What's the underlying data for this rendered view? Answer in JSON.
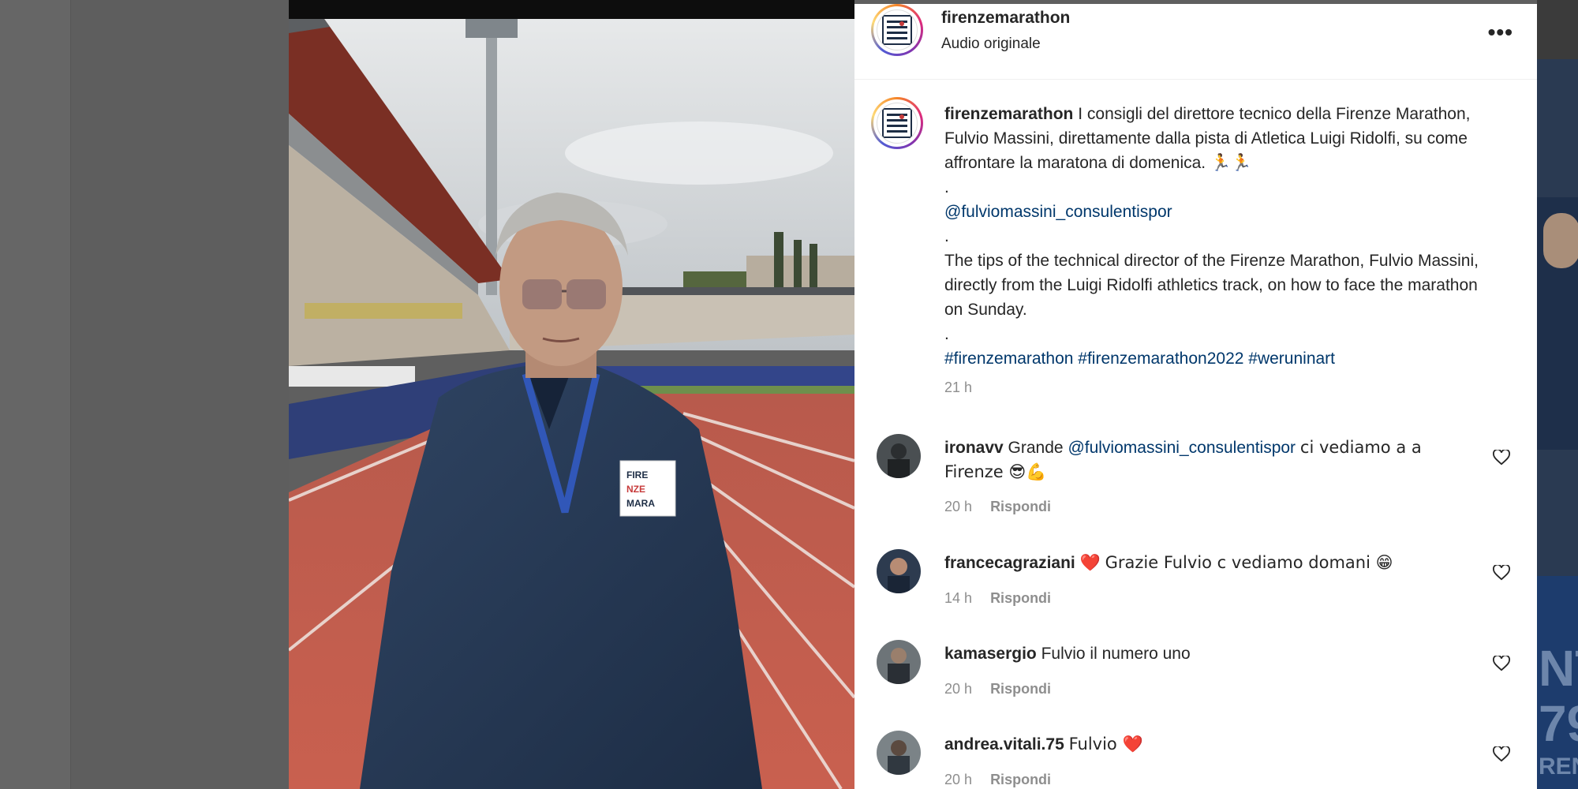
{
  "header": {
    "username": "firenzemarathon",
    "subtitle": "Audio originale",
    "more_label": "•••"
  },
  "avatar_logo": "FIRENZE MARATHON",
  "caption": {
    "username": "firenzemarathon",
    "text_it": "I consigli del direttore tecnico della Firenze Marathon, Fulvio Massini, direttamente dalla pista di Atletica Luigi Ridolfi, su come affrontare la maratona di domenica.",
    "emoji": "🏃🏃",
    "dot": ".",
    "mention": "@fulviomassini_consulentispor",
    "text_en": "The tips of the technical director of the Firenze Marathon, Fulvio Massini, directly from the Luigi Ridolfi athletics track, on how to face the marathon on Sunday.",
    "hashtags": [
      "#firenzemarathon",
      "#firenzemarathon2022",
      "#weruninart"
    ],
    "time": "21 h"
  },
  "comments": [
    {
      "username": "ironavv",
      "pre": "Grande",
      "mention": "@fulviomassini_consulentispor",
      "text": "ci vediamo a a Firenze 😎💪",
      "time": "20 h",
      "reply": "Rispondi"
    },
    {
      "username": "francecagraziani",
      "pre": "❤️",
      "text": "Grazie Fulvio c vediamo domani 😁",
      "time": "14 h",
      "reply": "Rispondi"
    },
    {
      "username": "kamasergio",
      "text": "Fulvio il numero uno",
      "time": "20 h",
      "reply": "Rispondi"
    },
    {
      "username": "andrea.vitali.75",
      "text": "Fulvio ❤️",
      "time": "20 h",
      "reply": "Rispondi"
    }
  ],
  "right_preview": {
    "text_lines": [
      "NT",
      "79",
      "REN"
    ]
  },
  "colors": {
    "link": "#00376b",
    "secondary": "#8e8e8e",
    "primary_text": "#262626",
    "track": "#c2584a"
  }
}
